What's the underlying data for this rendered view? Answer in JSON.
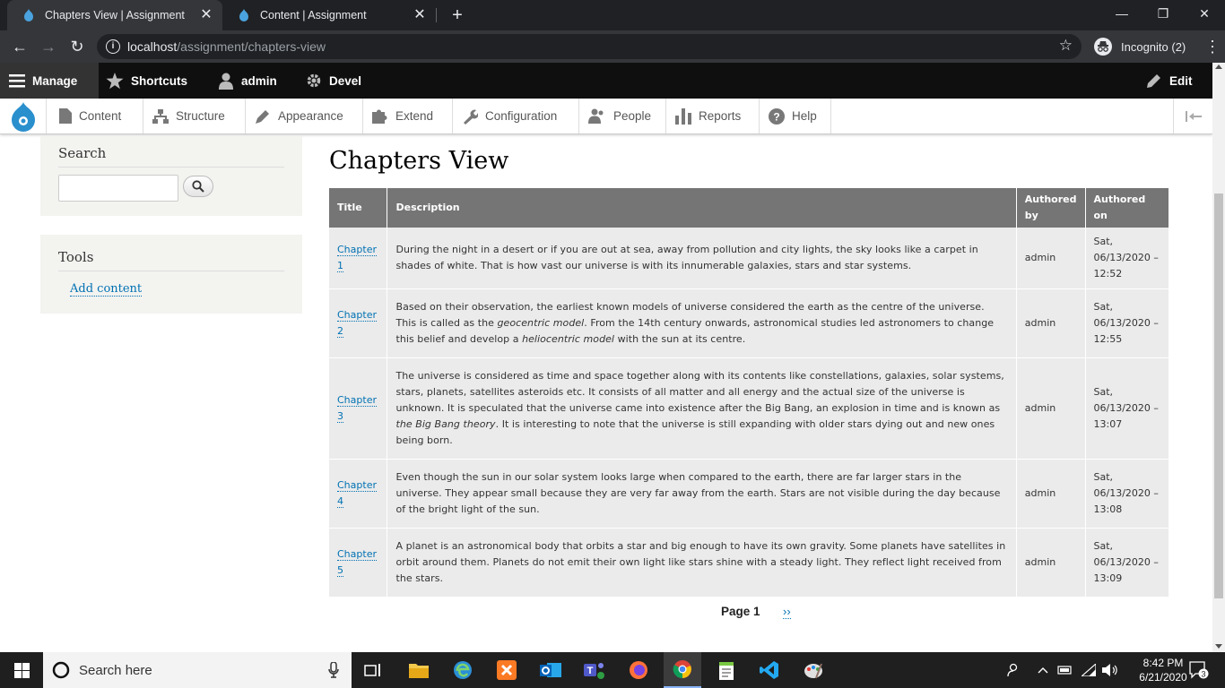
{
  "browser": {
    "tabs": [
      {
        "title": "Chapters View | Assignment",
        "active": true
      },
      {
        "title": "Content | Assignment",
        "active": false
      }
    ],
    "url_host": "localhost",
    "url_path": "/assignment/chapters-view",
    "incognito_label": "Incognito (2)"
  },
  "toolbar": {
    "manage": "Manage",
    "shortcuts": "Shortcuts",
    "user": "admin",
    "devel": "Devel",
    "edit": "Edit"
  },
  "tray": {
    "items": [
      "Content",
      "Structure",
      "Appearance",
      "Extend",
      "Configuration",
      "People",
      "Reports",
      "Help"
    ]
  },
  "sidebar": {
    "search_title": "Search",
    "search_value": "",
    "tools_title": "Tools",
    "tools_link": "Add content"
  },
  "main": {
    "title": "Chapters View",
    "columns": [
      "Title",
      "Description",
      "Authored by",
      "Authored on"
    ],
    "rows": [
      {
        "title": "Chapter 1",
        "description": "During the night in a desert or if you are out at sea, away from pollution and city lights, the sky looks like a carpet in shades of white. That is how vast our universe is with its innumerable galaxies, stars and star systems.",
        "author": "admin",
        "date": "Sat, 06/13/2020 – 12:52"
      },
      {
        "title": "Chapter 2",
        "description": "Based on their observation, the earliest known models of universe considered the earth as the centre of the universe. This is called as the |geocentric model|. From the 14th century onwards, astronomical studies led astronomers to change this belief and develop a |heliocentric model| with the sun at its centre.",
        "author": "admin",
        "date": "Sat, 06/13/2020 – 12:55"
      },
      {
        "title": "Chapter 3",
        "description": "The universe is considered as time and space together along with its contents like constellations, galaxies, solar systems, stars, planets, satellites asteroids etc. It consists of all matter and all energy and the actual size of the universe is unknown. It is speculated that the universe came into existence after the Big Bang, an explosion in time and is known as |the Big Bang theory|. It is interesting to note that the universe is still expanding with older stars dying out and new ones being born.",
        "author": "admin",
        "date": "Sat, 06/13/2020 – 13:07"
      },
      {
        "title": "Chapter 4",
        "description": "Even though the sun in our solar system looks large when compared to the earth, there are far larger stars in the universe. They appear small because they are very far away from the earth. Stars are not visible during the day because of the bright light of the sun.",
        "author": "admin",
        "date": "Sat, 06/13/2020 – 13:08"
      },
      {
        "title": "Chapter 5",
        "description": "A planet is an astronomical body that orbits a star and big enough to have its own gravity. Some planets have satellites in orbit around them. Planets do not emit their own light like stars shine with a steady light. They reflect light received from the stars.",
        "author": "admin",
        "date": "Sat, 06/13/2020 – 13:09"
      }
    ],
    "pager_current": "Page 1",
    "pager_next": "››"
  },
  "taskbar": {
    "search_placeholder": "Search here",
    "time": "8:42 PM",
    "date": "6/21/2020",
    "notifications": "3"
  },
  "colors": {
    "link": "#0071b3",
    "header_bg": "#757575",
    "cell_bg": "#ebebeb",
    "toolbar_bg": "#0f0f0f"
  }
}
